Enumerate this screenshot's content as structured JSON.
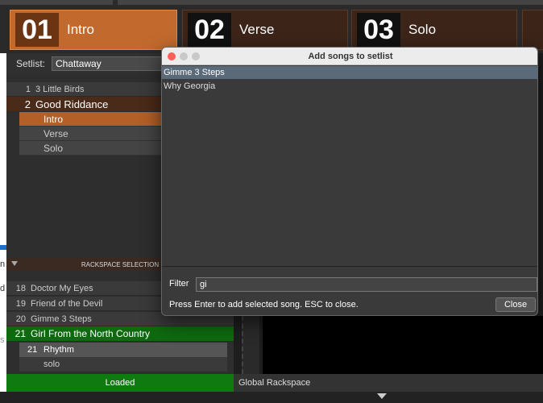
{
  "parts": [
    {
      "num": "01",
      "name": "Intro"
    },
    {
      "num": "02",
      "name": "Verse"
    },
    {
      "num": "03",
      "name": "Solo"
    }
  ],
  "setlist": {
    "label": "Setlist:",
    "value": "Chattaway",
    "songs": [
      {
        "num": "1",
        "name": "3 Little Birds"
      },
      {
        "num": "2",
        "name": "Good Riddance"
      }
    ],
    "song_parts": [
      "Intro",
      "Verse",
      "Solo"
    ]
  },
  "rackspace": {
    "header": "RACKSPACE SELECTION",
    "songs": [
      {
        "num": "18",
        "name": "Doctor My Eyes"
      },
      {
        "num": "19",
        "name": "Friend of the Devil"
      },
      {
        "num": "20",
        "name": "Gimme 3 Steps"
      },
      {
        "num": "21",
        "name": "Girl From the North Country"
      }
    ],
    "variations": [
      {
        "num": "21",
        "name": "Rhythm"
      },
      {
        "num": "",
        "name": "solo"
      }
    ],
    "status": "Loaded"
  },
  "global_rackspace": "Global Rackspace",
  "dialog": {
    "title": "Add songs to setlist",
    "results": [
      "Gimme 3 Steps",
      "Why Georgia"
    ],
    "filter_label": "Filter",
    "filter_value": "gi",
    "hint": "Press Enter to add selected song. ESC to close.",
    "close_label": "Close"
  },
  "edge_glyphs": [
    "n",
    "d",
    "s"
  ],
  "colors": {
    "accent": "#c26a2e",
    "loaded": "#0f7a0f",
    "selection": "#5a6a78"
  }
}
